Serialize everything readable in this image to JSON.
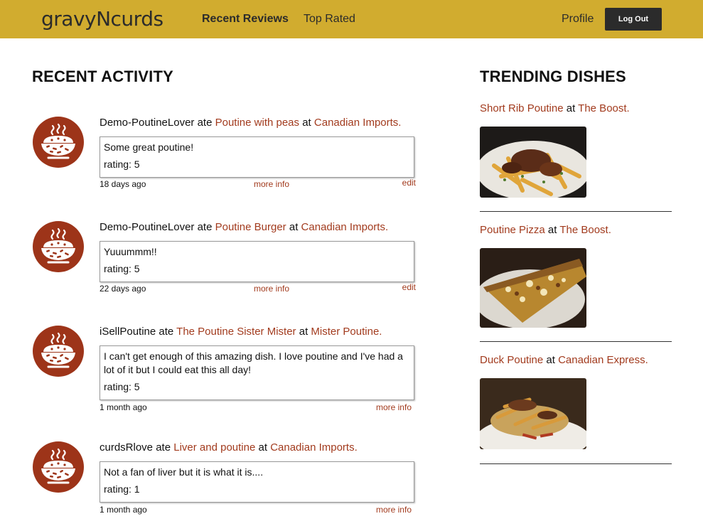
{
  "header": {
    "brand": "gravyNcurds",
    "nav": {
      "recent": "Recent Reviews",
      "top": "Top Rated",
      "profile": "Profile"
    },
    "logout": "Log Out",
    "bar_color": "#d1ac2f"
  },
  "recent": {
    "title": "RECENT ACTIVITY",
    "items": [
      {
        "user": "Demo-PoutineLover",
        "ate": "ate",
        "dish": "Poutine with peas",
        "at": "at",
        "place": "Canadian Imports.",
        "comment": "Some great poutine!",
        "rating": "rating: 5",
        "time": "18 days ago",
        "more": "more info",
        "edit": "edit"
      },
      {
        "user": "Demo-PoutineLover",
        "ate": "ate",
        "dish": "Poutine Burger",
        "at": "at",
        "place": "Canadian Imports.",
        "comment": "Yuuummm!!",
        "rating": "rating: 5",
        "time": "22 days ago",
        "more": "more info",
        "edit": "edit"
      },
      {
        "user": "iSellPoutine",
        "ate": "ate",
        "dish": "The Poutine Sister Mister",
        "at": "at",
        "place": "Mister Poutine.",
        "comment": "I can't get enough of this amazing dish. I love poutine and I've had a lot of it but I could eat this all day!",
        "rating": "rating: 5",
        "time": "1 month ago",
        "more": "more info"
      },
      {
        "user": "curdsRlove",
        "ate": "ate",
        "dish": "Liver and poutine",
        "at": "at",
        "place": "Canadian Imports.",
        "comment": "Not a fan of liver but it is what it is....",
        "rating": "rating: 1",
        "time": "1 month ago",
        "more": "more info"
      }
    ]
  },
  "trending": {
    "title": "TRENDING DISHES",
    "items": [
      {
        "dish": "Short Rib Poutine",
        "at": "at",
        "place": "The Boost.",
        "image": "short-rib-poutine-photo"
      },
      {
        "dish": "Poutine Pizza",
        "at": "at",
        "place": "The Boost.",
        "image": "poutine-pizza-photo"
      },
      {
        "dish": "Duck Poutine",
        "at": "at",
        "place": "Canadian Express.",
        "image": "duck-poutine-photo"
      }
    ]
  },
  "colors": {
    "accent": "#a23b1e",
    "avatar": "#9d3419",
    "button": "#2b2b2b"
  },
  "icons": {
    "avatar": "poutine-bowl-icon"
  }
}
